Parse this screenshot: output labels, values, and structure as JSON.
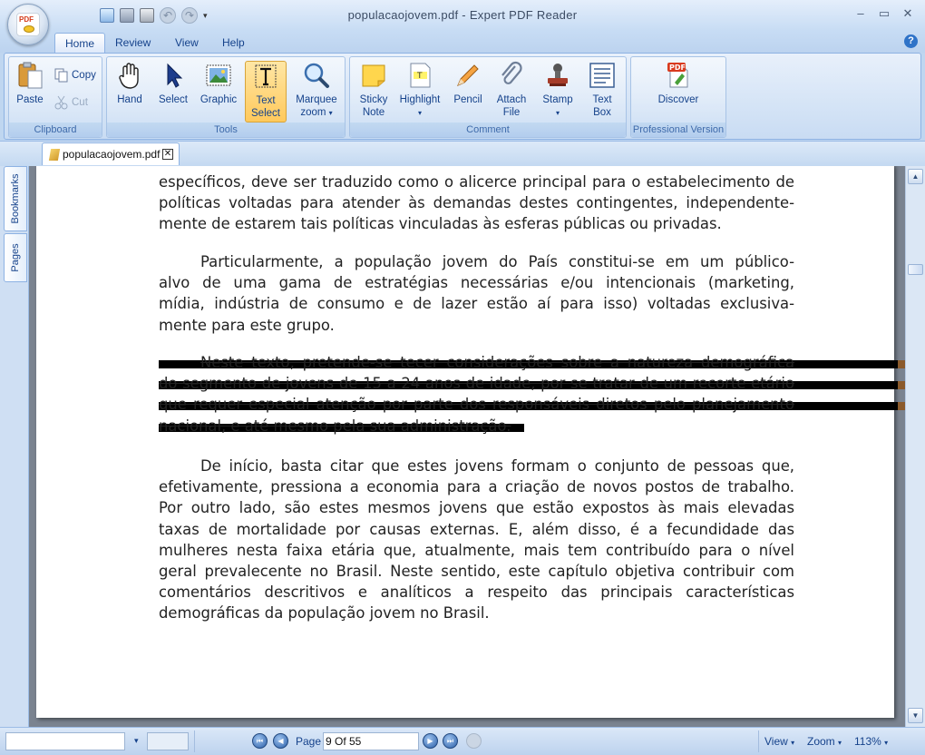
{
  "app": {
    "title": "populacaojovem.pdf - Expert PDF Reader",
    "orb_label": "PDF"
  },
  "window_controls": {
    "minimize": "–",
    "maximize": "▭",
    "close": "✕"
  },
  "tabs": [
    {
      "label": "Home",
      "active": true
    },
    {
      "label": "Review",
      "active": false
    },
    {
      "label": "View",
      "active": false
    },
    {
      "label": "Help",
      "active": false
    }
  ],
  "help_icon": "?",
  "ribbon": {
    "clipboard": {
      "label": "Clipboard",
      "paste": "Paste",
      "copy": "Copy",
      "cut": "Cut"
    },
    "tools": {
      "label": "Tools",
      "hand": "Hand",
      "select": "Select",
      "graphic": "Graphic",
      "text_select_1": "Text",
      "text_select_2": "Select",
      "marquee_1": "Marquee",
      "marquee_2": "zoom"
    },
    "comment": {
      "label": "Comment",
      "sticky_1": "Sticky",
      "sticky_2": "Note",
      "highlight": "Highlight",
      "pencil": "Pencil",
      "attach_1": "Attach",
      "attach_2": "File",
      "stamp": "Stamp",
      "textbox_1": "Text",
      "textbox_2": "Box"
    },
    "pro": {
      "label": "Professional Version",
      "discover": "Discover",
      "badge": "PDF"
    }
  },
  "document_tab": {
    "label": "populacaojovem.pdf",
    "close": "✕"
  },
  "side_tabs": {
    "bookmarks": "Bookmarks",
    "pages": "Pages"
  },
  "document": {
    "para0": [
      "específicos, deve ser traduzido como o alicerce principal para o estabelecimento de",
      "políticas voltadas para atender às demandas destes contingentes, independente-",
      "mente de estarem tais políticas vinculadas às esferas públicas ou privadas."
    ],
    "para1": [
      "Particularmente, a população jovem do País constitui-se em um público-",
      "alvo de uma gama de estratégias necessárias e/ou intencionais (marketing,",
      "mídia, indústria de consumo e de lazer estão aí para isso) voltadas exclusiva-",
      "mente para este grupo."
    ],
    "para2": [
      "Neste texto, pretende-se tecer considerações sobre a natureza demográfica",
      "do segmento de jovens de 15 a 24 anos de idade, por se tratar de um recorte etário",
      "que requer especial atenção por parte dos responsáveis diretos pelo planejamento",
      "nacional, e até mesmo pela sua administração."
    ],
    "para3": [
      "De início, basta citar que estes jovens formam o conjunto de pessoas que,",
      "efetivamente, pressiona a economia para a criação de novos postos de trabalho.",
      "Por outro lado, são estes mesmos jovens que estão expostos às mais elevadas",
      "taxas de mortalidade por causas externas. E, além disso, é a fecundidade das",
      "mulheres nesta faixa etária que, atualmente, mais tem contribuído para o nível",
      "geral prevalecente no Brasil. Neste sentido, este capítulo objetiva contribuir com",
      "comentários descritivos e analíticos a respeito das principais características",
      "demográficas da população jovem no Brasil."
    ]
  },
  "statusbar": {
    "page_label": "Page",
    "page_value": "9 Of 55",
    "view": "View",
    "zoom": "Zoom",
    "zoom_value": "113%"
  },
  "colors": {
    "accent": "#15428b",
    "ribbon": "#d5e4f6",
    "highlight_strike": "#000000",
    "active_tool": "#ffc95c"
  }
}
